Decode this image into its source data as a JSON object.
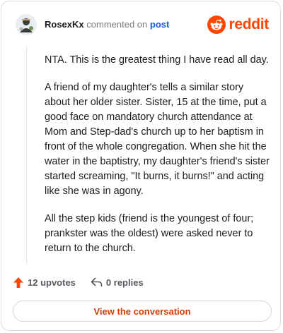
{
  "header": {
    "username": "RosexKx",
    "action_text": "commented on",
    "post_link": "post",
    "brand_name": "reddit",
    "brand_color": "#ff4500",
    "avatar_icon": "avatar-icon"
  },
  "comment": {
    "paragraphs": [
      "NTA. This is the greatest thing I have read all day.",
      "A friend of my daughter's tells a similar story about her older sister. Sister, 15 at the time, put a good face on mandatory church attendance at Mom and Step-dad's church up to her baptism in front of the whole congregation. When she hit the water in the baptistry, my daughter's friend's sister started screaming, \"It burns, it burns!\" and acting like she was in agony.",
      "All the step kids (friend is the youngest of four; prankster was the oldest) were asked never to return to the church."
    ]
  },
  "actions": {
    "upvotes_label": "12 upvotes",
    "replies_label": "0 replies",
    "upvote_icon": "upvote-arrow-icon",
    "reply_icon": "reply-arrow-icon",
    "upvote_color": "#ff4500"
  },
  "footer": {
    "button_label": "View the conversation",
    "button_color": "#d93a00"
  }
}
